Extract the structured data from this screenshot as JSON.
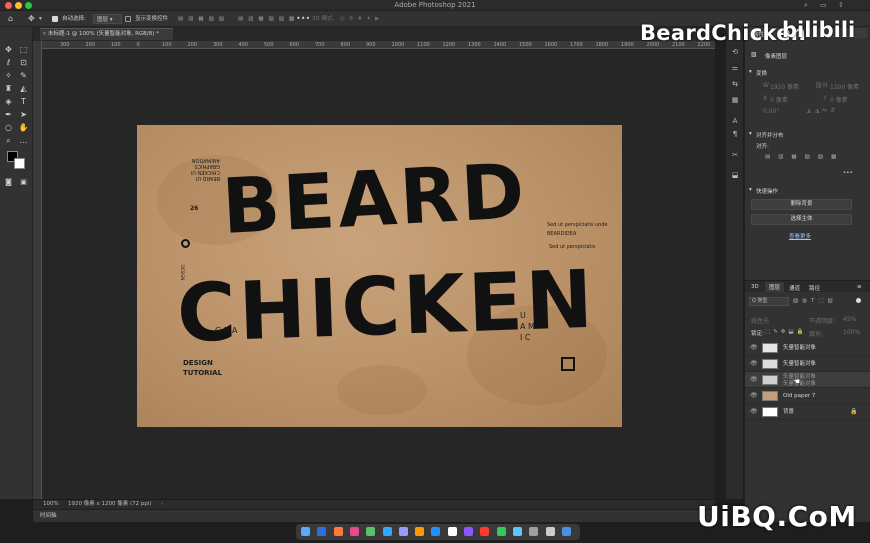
{
  "app": {
    "title": "Adobe Photoshop 2021",
    "traffic": [
      "#ff5f57",
      "#febc2e",
      "#28c840"
    ]
  },
  "options_bar": {
    "auto_select_label": "自动选择:",
    "auto_select_value": "图层",
    "show_transform_label": "显示变换控件",
    "mode_3d_label": "3D 模式:"
  },
  "doc_tab": {
    "title": "未标题-1 @ 100% (矢量智能对象, RGB/8) *"
  },
  "ruler": {
    "ticks": [
      "300",
      "200",
      "100",
      "0",
      "100",
      "200",
      "300",
      "400",
      "500",
      "600",
      "700",
      "800",
      "900",
      "1000",
      "1100",
      "1200",
      "1300",
      "1400",
      "1500",
      "1600",
      "1700",
      "1800",
      "1900",
      "2000",
      "2100",
      "2200"
    ]
  },
  "canvas": {
    "headline_1": "BEARD",
    "headline_2": "CHICKEN",
    "sideline_lines": [
      "BEARD UI",
      "CHICKEN UI",
      "GRAPHICS",
      "ANIMATION"
    ],
    "number": "26",
    "right_note_1": "Sed ut perspiciatis unde",
    "right_note_2": "BEARDIDEA",
    "right_note_3": "Sed ut perspiciatis",
    "left_gra": "G R A",
    "right_letters": [
      "U",
      "A M",
      "I C"
    ],
    "design": "DESIGN",
    "tutorial": "TUTORIAL",
    "vertical_text": "DESIGN"
  },
  "status": {
    "zoom": "100%",
    "doc_size": "1920 像素 x 1200 像素 (72 ppi)"
  },
  "timeline_label": "时间轴",
  "properties": {
    "tab_label": "属性",
    "object_type": "像素图层",
    "transform_label": "变换",
    "w_label": "W",
    "h_label": "H",
    "w_value": "1920 像素",
    "h_value": "1200 像素",
    "x_label": "X",
    "y_label": "Y",
    "x_value": "0 像素",
    "y_value": "0 像素",
    "angle_value": "0.00°",
    "align_label": "对齐并分布",
    "align_sub": "对齐:",
    "quick_actions_label": "快速操作",
    "remove_bg": "删除背景",
    "select_subject": "选择主体",
    "learn_more": "查看更多"
  },
  "layers_panel": {
    "tabs": [
      "3D",
      "图层",
      "通道",
      "路径"
    ],
    "filter_label": "Q 类型",
    "blend_mode": "线性光",
    "opacity_label": "不透明度:",
    "opacity_value": "45%",
    "lock_label": "锁定:",
    "fill_label": "填充:",
    "fill_value": "100%",
    "layers": [
      {
        "name": "矢量智能对象",
        "thumb": "#e6e6e6"
      },
      {
        "name": "矢量智能对象",
        "thumb": "#dcdcdc"
      },
      {
        "name": "矢量智能对象",
        "thumb": "#cfcfcf"
      },
      {
        "name": "Old paper 7",
        "thumb": "#c39e78"
      },
      {
        "name": "背景",
        "thumb": "#ffffff"
      }
    ],
    "drag_ghost_1": "矢量智能对象",
    "drag_ghost_2": "矢量智能对象"
  },
  "branding": {
    "channel": "BeardChicken",
    "platform": "bilibili",
    "watermark": "UiBQ.CoM"
  }
}
